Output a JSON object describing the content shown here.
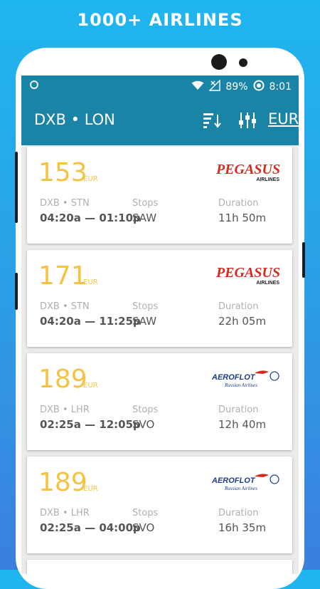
{
  "promo": {
    "title": "1000+ AIRLINES"
  },
  "status_bar": {
    "battery": "89%",
    "time": "8:01"
  },
  "app_bar": {
    "route": "DXB • LON",
    "sort_icon": "sort-descending-icon",
    "filter_icon": "sliders-icon",
    "currency": "EUR"
  },
  "labels": {
    "stops": "Stops",
    "duration": "Duration"
  },
  "flights": [
    {
      "price": "153",
      "currency": "EUR",
      "airline": "PEGASUS",
      "airline_sub": "AIRLINES",
      "route": "DXB • STN",
      "times": "04:20a — 01:10p",
      "stops": "SAW",
      "duration": "11h 50m"
    },
    {
      "price": "171",
      "currency": "EUR",
      "airline": "PEGASUS",
      "airline_sub": "AIRLINES",
      "route": "DXB • STN",
      "times": "04:20a — 11:25p",
      "stops": "SAW",
      "duration": "22h 05m"
    },
    {
      "price": "189",
      "currency": "EUR",
      "airline": "AEROFLOT",
      "airline_sub": "Russian Airlines",
      "route": "DXB • LHR",
      "times": "02:25a — 12:05p",
      "stops": "SVO",
      "duration": "12h 40m"
    },
    {
      "price": "189",
      "currency": "EUR",
      "airline": "AEROFLOT",
      "airline_sub": "Russian Airlines",
      "route": "DXB • LHR",
      "times": "02:25a — 04:00p",
      "stops": "SVO",
      "duration": "16h 35m"
    }
  ],
  "colors": {
    "primary": "#1a84a6",
    "price": "#f5c243",
    "pegasus_red": "#d52b1e",
    "aeroflot_blue": "#1d3c8c"
  }
}
